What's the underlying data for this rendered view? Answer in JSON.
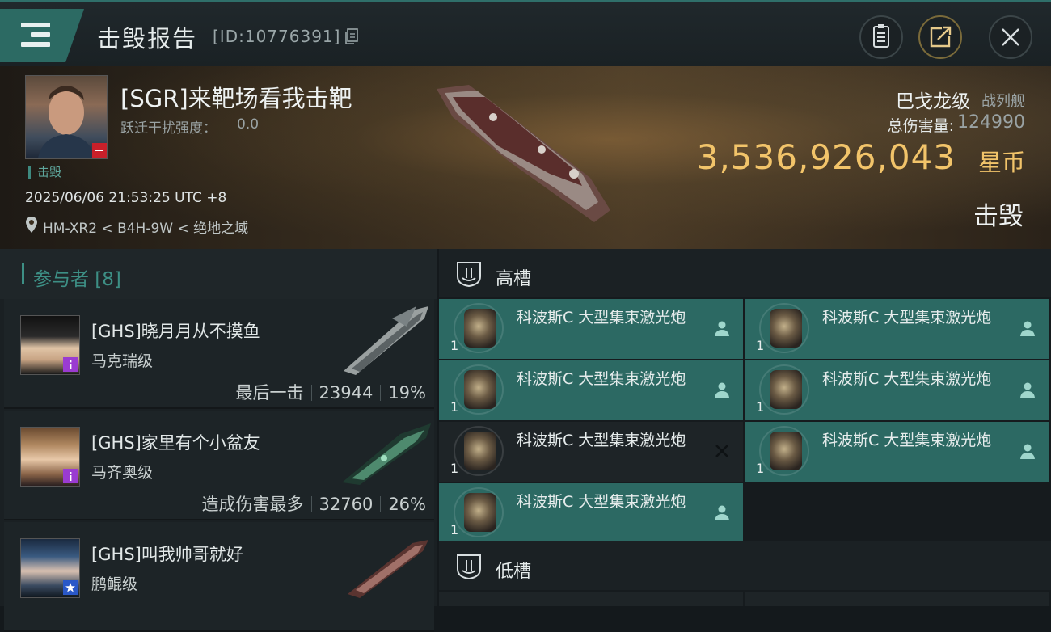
{
  "header": {
    "title": "击毁报告",
    "report_id": "[ID:10776391]"
  },
  "victim": {
    "name": "[SGR]来靶场看我击靶",
    "warp_label": "跃迁干扰强度：",
    "warp_value": "0.0",
    "status_tag": "击毁",
    "datetime": "2025/06/06 21:53:25 UTC +8",
    "location": "HM-XR2 < B4H-9W < 绝地之域",
    "ship_class": "巴戈龙级",
    "ship_type": "战列舰",
    "damage_label": "总伤害量:",
    "damage_value": "124990",
    "isk_value": "3,536,926,043",
    "isk_unit": "星币",
    "kill_status": "击毁"
  },
  "participants": {
    "title": "参与者 [8]",
    "list": [
      {
        "name": "[GHS]晓月月从不摸鱼",
        "ship": "马克瑞级",
        "tag": "最后一击",
        "damage": "23944",
        "percent": "19%",
        "badge_color": "#9a3bd1"
      },
      {
        "name": "[GHS]家里有个小盆友",
        "ship": "马齐奥级",
        "tag": "造成伤害最多",
        "damage": "32760",
        "percent": "26%",
        "badge_color": "#9a3bd1"
      },
      {
        "name": "[GHS]叫我帅哥就好",
        "ship": "鹏鲲级",
        "tag": "",
        "damage": "",
        "percent": "",
        "badge_color": "#2a58c8"
      }
    ]
  },
  "slots": {
    "high": {
      "title": "高槽",
      "modules": [
        {
          "name": "科波斯C 大型集束激光炮",
          "qty": "1",
          "status": "dropped"
        },
        {
          "name": "科波斯C 大型集束激光炮",
          "qty": "1",
          "status": "dropped"
        },
        {
          "name": "科波斯C 大型集束激光炮",
          "qty": "1",
          "status": "dropped"
        },
        {
          "name": "科波斯C 大型集束激光炮",
          "qty": "1",
          "status": "dropped"
        },
        {
          "name": "科波斯C 大型集束激光炮",
          "qty": "1",
          "status": "destroyed"
        },
        {
          "name": "科波斯C 大型集束激光炮",
          "qty": "1",
          "status": "dropped"
        },
        {
          "name": "科波斯C 大型集束激光炮",
          "qty": "1",
          "status": "dropped"
        }
      ]
    },
    "low": {
      "title": "低槽"
    }
  },
  "icons": {
    "menu": "menu-icon",
    "copy": "copy-icon",
    "clipboard": "clipboard-icon",
    "share": "share-icon",
    "close": "close-icon",
    "location": "location-pin-icon",
    "high_slot": "high-slot-icon",
    "low_slot": "low-slot-icon",
    "dropped": "person-icon",
    "destroyed": "x-icon"
  },
  "colors": {
    "accent": "#2c6963",
    "isk": "#f2c46a",
    "victim_badge": "#c8202a"
  }
}
